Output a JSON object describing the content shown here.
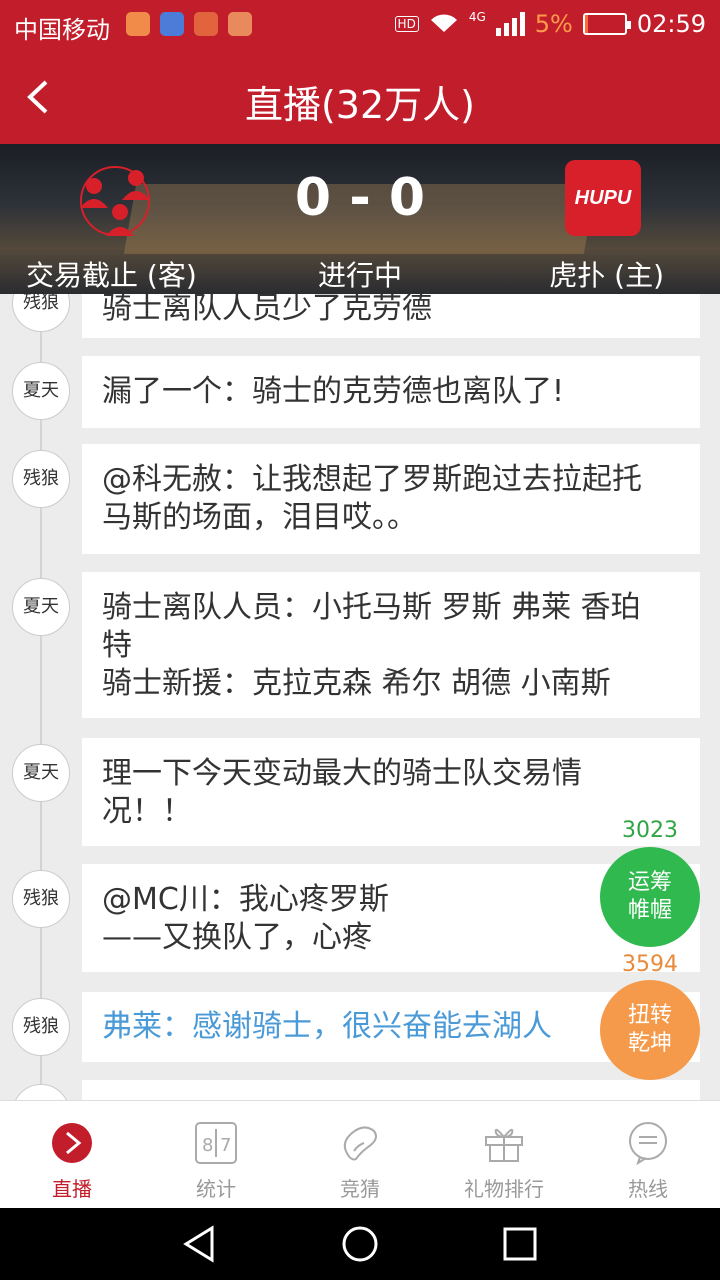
{
  "status_bar": {
    "carrier": "中国移动",
    "network": "4G",
    "hd": "HD",
    "battery_percent": "5%",
    "time": "02:59"
  },
  "header": {
    "title": "直播(32万人)"
  },
  "scoreboard": {
    "score": "0 - 0",
    "away_label": "交易截止 (客)",
    "status": "进行中",
    "home_label": "虎扑 (主)",
    "home_logo_text": "HUPU"
  },
  "feed": [
    {
      "user": "残狼",
      "lines": [
        "骑士离队人员少了克劳德"
      ]
    },
    {
      "user": "夏天",
      "lines": [
        "漏了一个：骑士的克劳德也离队了!"
      ]
    },
    {
      "user": "残狼",
      "lines": [
        "@科无赦：让我想起了罗斯跑过去拉起托",
        "马斯的场面，泪目哎。。"
      ]
    },
    {
      "user": "夏天",
      "lines": [
        "骑士离队人员：小托马斯 罗斯 弗莱 香珀",
        "特",
        "骑士新援：克拉克森 希尔 胡德 小南斯"
      ]
    },
    {
      "user": "夏天",
      "lines": [
        "理一下今天变动最大的骑士队交易情",
        "况！！"
      ]
    },
    {
      "user": "残狼",
      "lines": [
        "@MC川：我心疼罗斯",
        "——又换队了，心疼"
      ]
    },
    {
      "user": "残狼",
      "lines": [
        "弗莱：感谢骑士，很兴奋能去湖人"
      ]
    }
  ],
  "float_buttons": {
    "green": {
      "count": "3023",
      "label_1": "运筹",
      "label_2": "帷幄",
      "color": "#2fb94e"
    },
    "orange": {
      "count": "3594",
      "label_1": "扭转",
      "label_2": "乾坤",
      "color": "#f59a4a"
    }
  },
  "tabs": [
    {
      "label": "直播",
      "icon": "live-play-icon",
      "active": true
    },
    {
      "label": "统计",
      "icon": "stats-scoreboard-icon",
      "active": false
    },
    {
      "label": "竞猜",
      "icon": "bean-icon",
      "active": false
    },
    {
      "label": "礼物排行",
      "icon": "gift-icon",
      "active": false
    },
    {
      "label": "热线",
      "icon": "chat-icon",
      "active": false
    }
  ],
  "colors": {
    "brand": "#c21d2b",
    "highlight_text": "#4a9ad8"
  }
}
